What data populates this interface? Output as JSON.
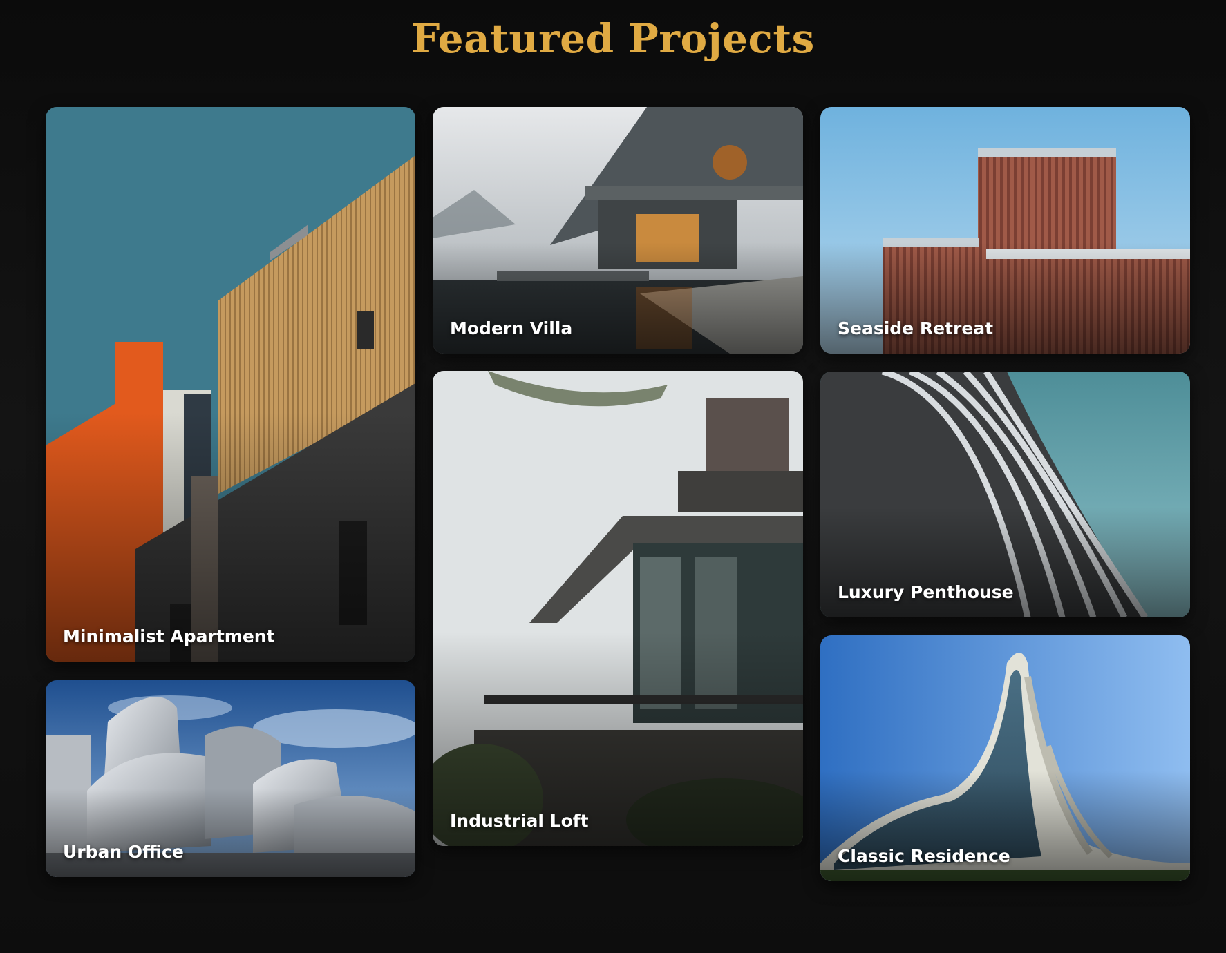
{
  "section": {
    "title": "Featured Projects",
    "accent_color": "#e0aa43",
    "background_color": "#0f0f0f"
  },
  "projects": [
    {
      "label": "Minimalist Apartment",
      "image": "orange-and-wood-facade-photo"
    },
    {
      "label": "Urban Office",
      "image": "curved-steel-concert-hall-photo"
    },
    {
      "label": "Modern Villa",
      "image": "concrete-lakeside-villa-in-fog-photo"
    },
    {
      "label": "Industrial Loft",
      "image": "cantilevered-glass-house-photo"
    },
    {
      "label": "Seaside Retreat",
      "image": "wood-slat-building-blue-sky-photo"
    },
    {
      "label": "Luxury Penthouse",
      "image": "curving-striped-balconies-photo"
    },
    {
      "label": "Classic Residence",
      "image": "wave-shaped-glass-building-photo"
    }
  ]
}
